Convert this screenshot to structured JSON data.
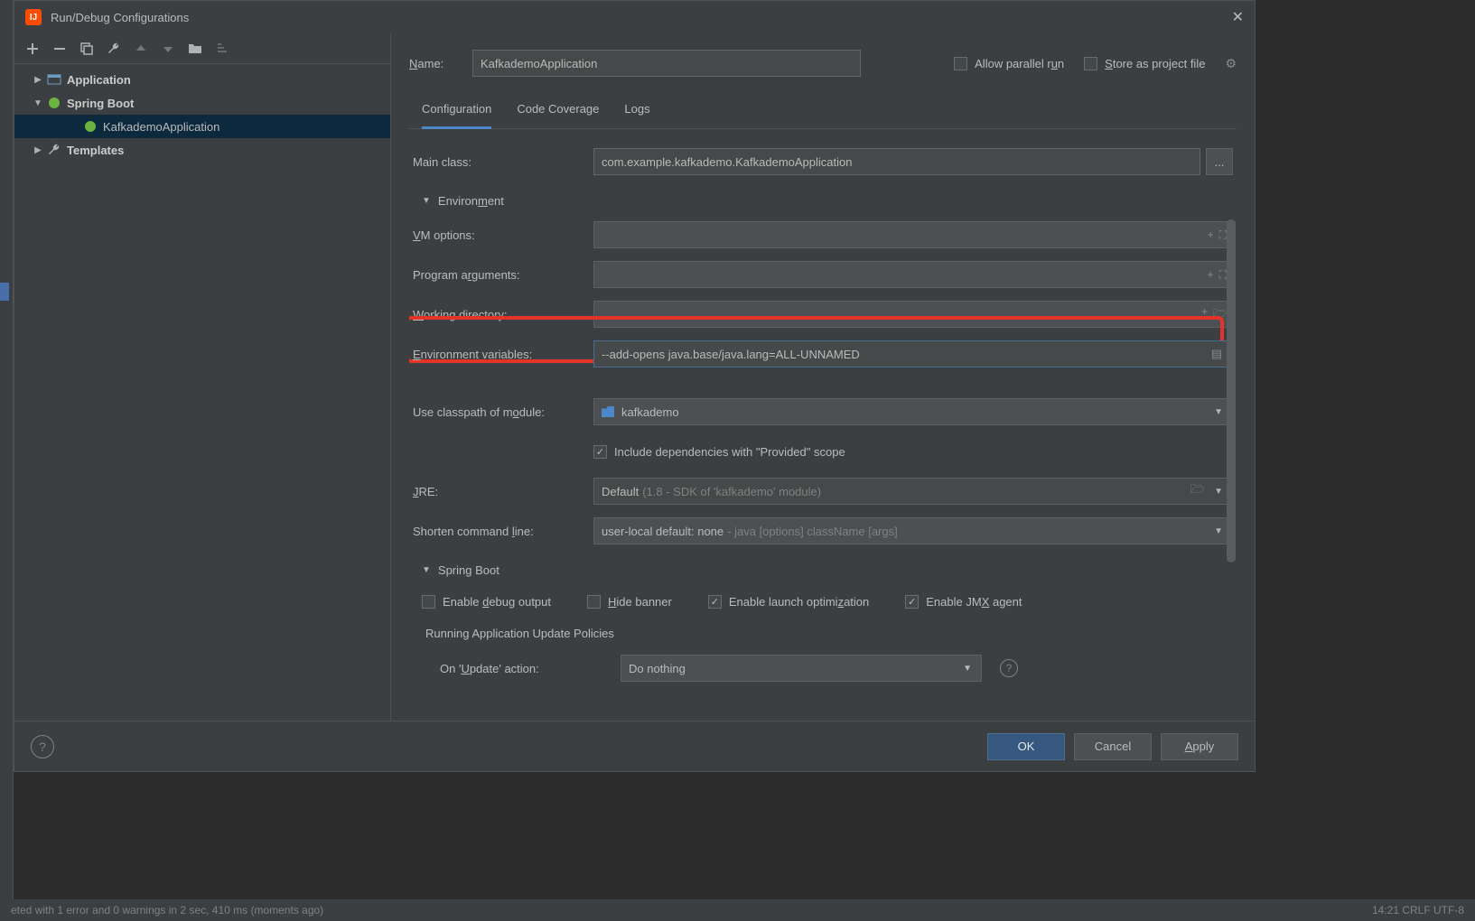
{
  "titlebar": {
    "title": "Run/Debug Configurations"
  },
  "sidebar": {
    "items": [
      {
        "label": "Application",
        "bold": true,
        "expanded": true
      },
      {
        "label": "Spring Boot",
        "bold": true,
        "expanded": true
      },
      {
        "label": "KafkademoApplication",
        "bold": false,
        "selected": true
      },
      {
        "label": "Templates",
        "bold": true,
        "expanded": false
      }
    ]
  },
  "name_row": {
    "label": "Name:",
    "value": "KafkademoApplication",
    "allow_parallel": "Allow parallel run",
    "store_as_file": "Store as project file"
  },
  "tabs": [
    "Configuration",
    "Code Coverage",
    "Logs"
  ],
  "form": {
    "main_class": {
      "label": "Main class:",
      "value": "com.example.kafkademo.KafkademoApplication"
    },
    "environment_section": "Environment",
    "vm_options": {
      "label": "VM options:",
      "value": ""
    },
    "program_args": {
      "label": "Program arguments:",
      "value": ""
    },
    "working_dir": {
      "label": "Working directory:",
      "value": ""
    },
    "env_vars": {
      "label": "Environment variables:",
      "value": "--add-opens java.base/java.lang=ALL-UNNAMED"
    },
    "classpath": {
      "label": "Use classpath of module:",
      "value": "kafkademo"
    },
    "include_provided": "Include dependencies with \"Provided\" scope",
    "jre": {
      "label": "JRE:",
      "value": "Default",
      "hint": "(1.8 - SDK of 'kafkademo' module)"
    },
    "shorten": {
      "label": "Shorten command line:",
      "value": "user-local default: none",
      "hint": " - java [options] className [args]"
    },
    "spring_section": "Spring Boot",
    "enable_debug": "Enable debug output",
    "hide_banner": "Hide banner",
    "enable_launch_opt": "Enable launch optimization",
    "enable_jmx": "Enable JMX agent",
    "running_policies": "Running Application Update Policies",
    "on_update": {
      "label": "On 'Update' action:",
      "value": "Do nothing"
    }
  },
  "footer": {
    "ok": "OK",
    "cancel": "Cancel",
    "apply": "Apply"
  },
  "status": {
    "left": "eted with 1 error and 0 warnings in 2 sec, 410 ms (moments ago)",
    "right": "14:21  CRLF  UTF-8"
  }
}
